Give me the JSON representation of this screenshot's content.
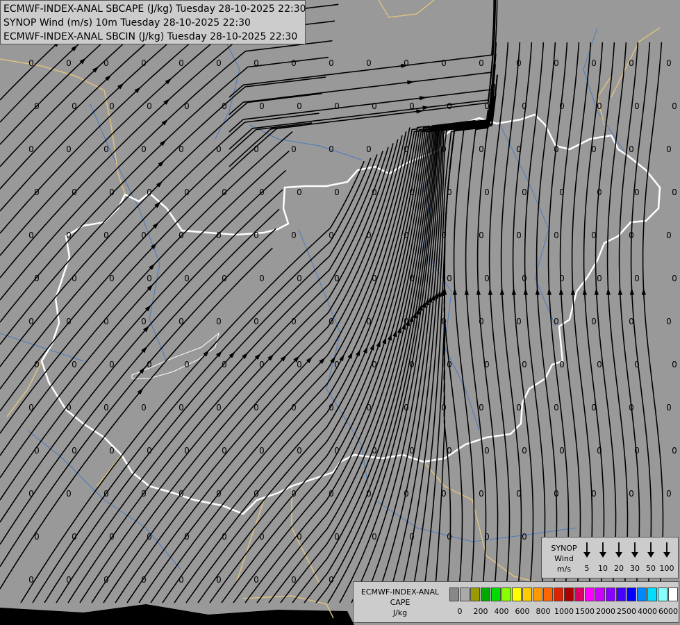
{
  "titles": {
    "line1": "ECMWF-INDEX-ANAL SBCAPE (J/kg) Tuesday 28-10-2025 22:30",
    "line2": "SYNOP Wind (m/s) 10m Tuesday 28-10-2025 22:30",
    "line3": "ECMWF-INDEX-ANAL SBCIN (J/kg) Tuesday 28-10-2025 22:30"
  },
  "map": {
    "cape_value_label": "0",
    "colors": {
      "background": "#999999",
      "border": "#ffffff",
      "neighbor_border": "#e0c080",
      "river": "#4a7bbf",
      "streamline": "#000000"
    }
  },
  "synop_legend": {
    "title_line1": "SYNOP",
    "title_line2": "Wind",
    "title_line3": "m/s",
    "values": [
      "5",
      "10",
      "20",
      "30",
      "50",
      "100"
    ]
  },
  "cape_legend": {
    "title_line1": "ECMWF-INDEX-ANAL",
    "title_line2": "CAPE",
    "title_line3": "J/kg",
    "colors": [
      "#888888",
      "#aaaaaa",
      "#999900",
      "#00aa00",
      "#00dd00",
      "#88ff00",
      "#ffff00",
      "#ffcc00",
      "#ff9900",
      "#ff6600",
      "#dd2200",
      "#aa0000",
      "#dd0066",
      "#ff00ff",
      "#cc00ff",
      "#8800ff",
      "#4400ff",
      "#0000ff",
      "#0088ff",
      "#00ddff",
      "#88ffff",
      "#ffffff"
    ],
    "ticks": [
      "0",
      "200",
      "400",
      "600",
      "800",
      "1000",
      "1500",
      "2000",
      "2500",
      "4000",
      "6000"
    ]
  }
}
